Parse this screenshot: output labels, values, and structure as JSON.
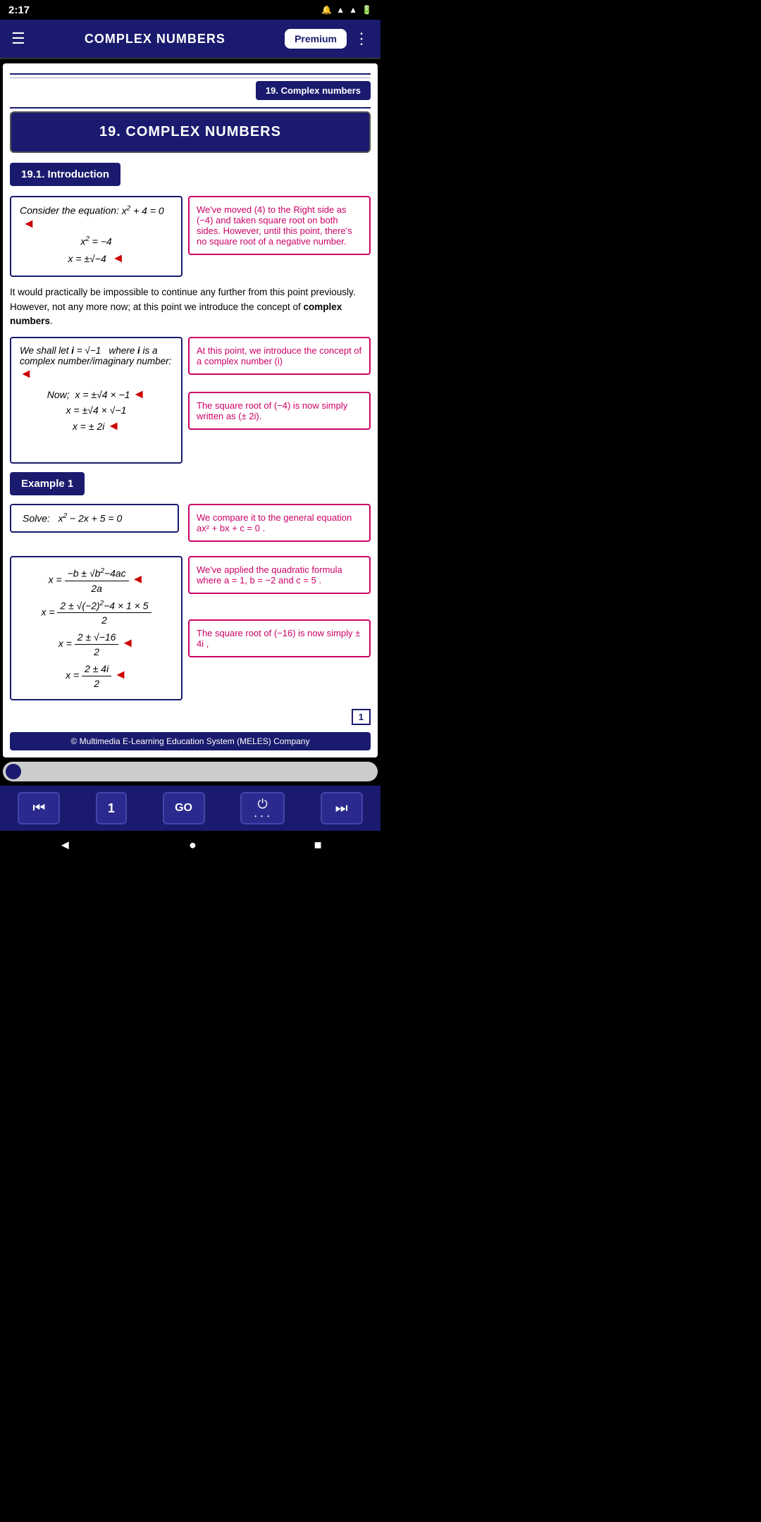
{
  "statusBar": {
    "time": "2:17",
    "icons": [
      "signal",
      "wifi",
      "battery"
    ]
  },
  "header": {
    "title": "COMPLEX NUMBERS",
    "premiumLabel": "Premium",
    "menuIcon": "☰",
    "moreIcon": "⋮"
  },
  "navBadge": "19. Complex numbers",
  "sectionTitle": "19. COMPLEX NUMBERS",
  "subsection": "19.1. Introduction",
  "intro": {
    "equation1Label": "Consider the equation:",
    "equation1": "x² + 4 = 0",
    "equation2": "x² = −4",
    "equation3": "x = ±√−4",
    "annotation1": "We've moved (4) to the Right side as (−4) and taken square root on both sides. However, until this point, there's no square root of a negative number."
  },
  "paragraph": "It would practically be impossible to continue any further from this point previously. However, not any more now; at this point we introduce the concept of ",
  "paragraphBold": "complex numbers",
  "paragraphEnd": ".",
  "imaginaryBox": {
    "line1": "We shall let i = √−1  where i is a complex number/imaginary number:",
    "line2": "Now;  x = ±√4 × −1",
    "line3": "x = ±√4 × √−1",
    "line4": "x = ± 2i"
  },
  "imaginaryAnnotation1": "At this point, we introduce the concept of a complex number (i)",
  "imaginaryAnnotation2": "The square root of (−4) is now simply written as (± 2i).",
  "example": {
    "label": "Example 1",
    "solveLabel": "Solve:",
    "equation": "x² − 2x + 5 = 0",
    "annotation1": "We compare it to the general equation  ax² + bx + c = 0 .",
    "quadFormula": "x = (−b ± √(b²−4ac)) / 2a",
    "quadLine1": "x = (2 ± √(−2)²−4×1×5) / 2",
    "annotation2": "We've applied the quadratic formula where  a = 1,  b = −2  and  c = 5 .",
    "quadLine2": "x = (2 ± √−16) / 2",
    "annotation3": "The square root of (−16) is now simply ± 4i ,",
    "quadLine3": "x = (2 ± 4i) / 2"
  },
  "pageNumber": "1",
  "copyright": "© Multimedia E-Learning Education System (MELES) Company",
  "bottomNav": {
    "back": "⏮",
    "pageNum": "1",
    "go": "GO",
    "power": "⏻",
    "forward": "⏭"
  }
}
